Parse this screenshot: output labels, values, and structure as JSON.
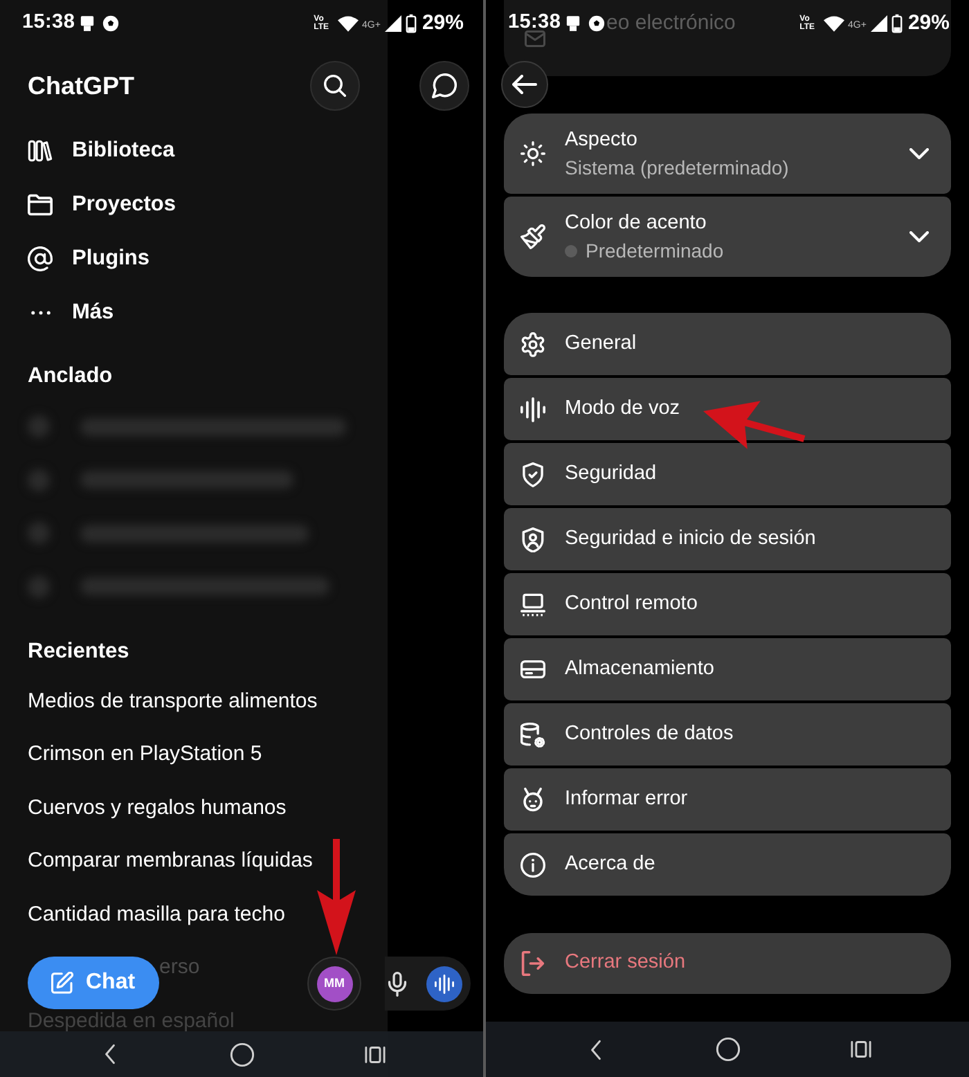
{
  "left_screen": {
    "status_bar": {
      "time": "15:38",
      "volte": [
        "Vo",
        "LTE"
      ],
      "network": "4G+",
      "battery": "29%"
    },
    "drawer": {
      "title": "ChatGPT",
      "menu": [
        "Biblioteca",
        "Proyectos",
        "Plugins",
        "Más"
      ],
      "pinned_heading": "Anclado",
      "recents_heading": "Recientes",
      "recents": [
        {
          "title": "Medios de transporte alimentos",
          "kind": "plain"
        },
        {
          "title": "Crimson en PlayStation 5",
          "kind": "plain"
        },
        {
          "title": "Cuervos y regalos humanos",
          "kind": "plain"
        },
        {
          "title": "Comparar membranas líquidas",
          "kind": "plain"
        },
        {
          "title": "Cantidad masilla para techo",
          "kind": "plain"
        },
        {
          "title": "erso",
          "kind": "covered"
        },
        {
          "title": "Despedida en español",
          "kind": "faded"
        }
      ]
    },
    "new_chat_button": "Chat",
    "avatar": {
      "initials": "MM",
      "marked": true
    }
  },
  "right_screen": {
    "status_bar": {
      "time": "15:38",
      "volte": [
        "Vo",
        "LTE"
      ],
      "network": "4G+",
      "battery": "29%"
    },
    "email_field": {
      "label": "eo electrónico"
    },
    "appearance": [
      {
        "title": "Aspecto",
        "subtitle": "Sistema (predeterminado)",
        "kind": "plain"
      },
      {
        "title": "Color de acento",
        "subtitle": "Predeterminado",
        "kind": "swatch"
      }
    ],
    "settings": [
      {
        "label": "General",
        "marked": false
      },
      {
        "label": "Modo de voz",
        "marked": true
      },
      {
        "label": "Seguridad",
        "marked": false
      },
      {
        "label": "Seguridad e inicio de sesión",
        "marked": false
      },
      {
        "label": "Control remoto",
        "marked": false
      },
      {
        "label": "Almacenamiento",
        "marked": false
      },
      {
        "label": "Controles de datos",
        "marked": false
      },
      {
        "label": "Informar error",
        "marked": false
      },
      {
        "label": "Acerca de",
        "marked": false
      }
    ],
    "logout": "Cerrar sesión"
  }
}
